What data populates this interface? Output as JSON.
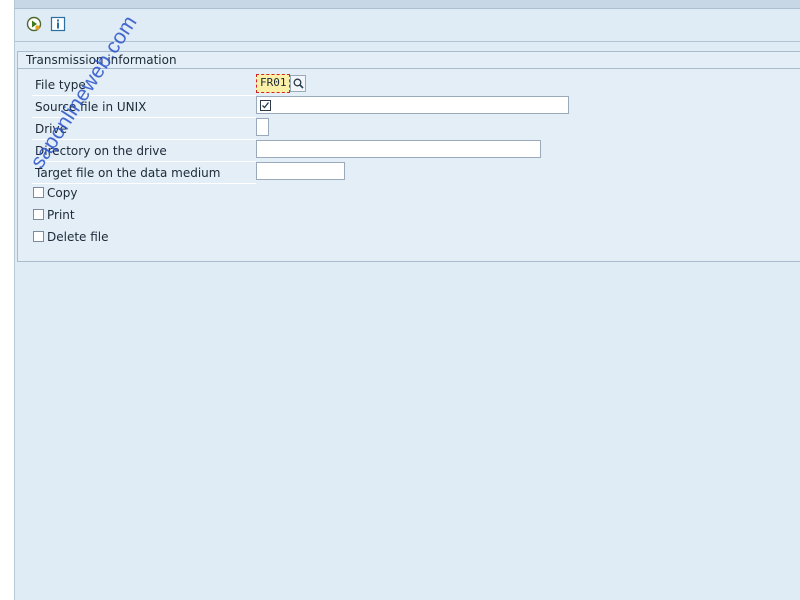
{
  "toolbar": {
    "execute_icon": "execute-icon",
    "info_icon": "info-icon"
  },
  "group": {
    "title": "Transmission information"
  },
  "fields": {
    "file_type": {
      "label": "File type",
      "value": "FR01"
    },
    "source_unix": {
      "label": "Source file in UNIX",
      "value": ""
    },
    "drive": {
      "label": "Drive",
      "value": ""
    },
    "directory": {
      "label": "Directory on the drive",
      "value": ""
    },
    "target_file": {
      "label": "Target file on the data medium",
      "value": ""
    }
  },
  "checkboxes": {
    "copy": {
      "label": "Copy",
      "checked": false
    },
    "print": {
      "label": "Print",
      "checked": false
    },
    "delete": {
      "label": "Delete file",
      "checked": false
    }
  },
  "watermark": "saponlineweb.com",
  "colors": {
    "background": "#dfebf5",
    "required_field": "#fbf0a8",
    "required_border": "#d2232a",
    "watermark": "#2850c8"
  }
}
